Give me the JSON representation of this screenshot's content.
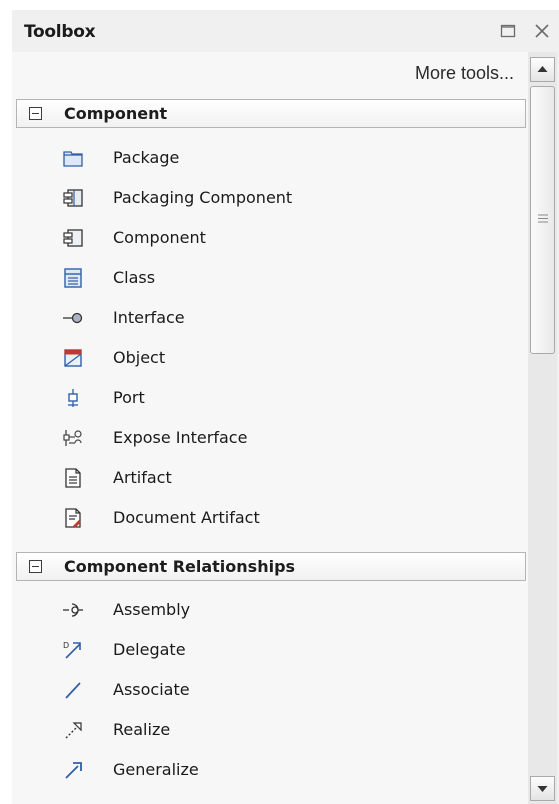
{
  "toolbox": {
    "title": "Toolbox",
    "more_tools": "More tools...",
    "sections": [
      {
        "label": "Component",
        "items": [
          {
            "label": "Package",
            "icon": "package-icon"
          },
          {
            "label": "Packaging Component",
            "icon": "packaging-component-icon"
          },
          {
            "label": "Component",
            "icon": "component-icon"
          },
          {
            "label": "Class",
            "icon": "class-icon"
          },
          {
            "label": "Interface",
            "icon": "interface-icon"
          },
          {
            "label": "Object",
            "icon": "object-icon"
          },
          {
            "label": "Port",
            "icon": "port-icon"
          },
          {
            "label": "Expose Interface",
            "icon": "expose-interface-icon"
          },
          {
            "label": "Artifact",
            "icon": "artifact-icon"
          },
          {
            "label": "Document Artifact",
            "icon": "document-artifact-icon"
          }
        ]
      },
      {
        "label": "Component Relationships",
        "items": [
          {
            "label": "Assembly",
            "icon": "assembly-icon"
          },
          {
            "label": "Delegate",
            "icon": "delegate-icon"
          },
          {
            "label": "Associate",
            "icon": "associate-icon"
          },
          {
            "label": "Realize",
            "icon": "realize-icon"
          },
          {
            "label": "Generalize",
            "icon": "generalize-icon"
          }
        ]
      }
    ]
  },
  "colors": {
    "panel_background": "#f0f0f0",
    "content_background": "#f7f7f7",
    "header_border": "#b4b4b4",
    "icon_blue": "#2f5fa8",
    "icon_red": "#c0392b"
  }
}
